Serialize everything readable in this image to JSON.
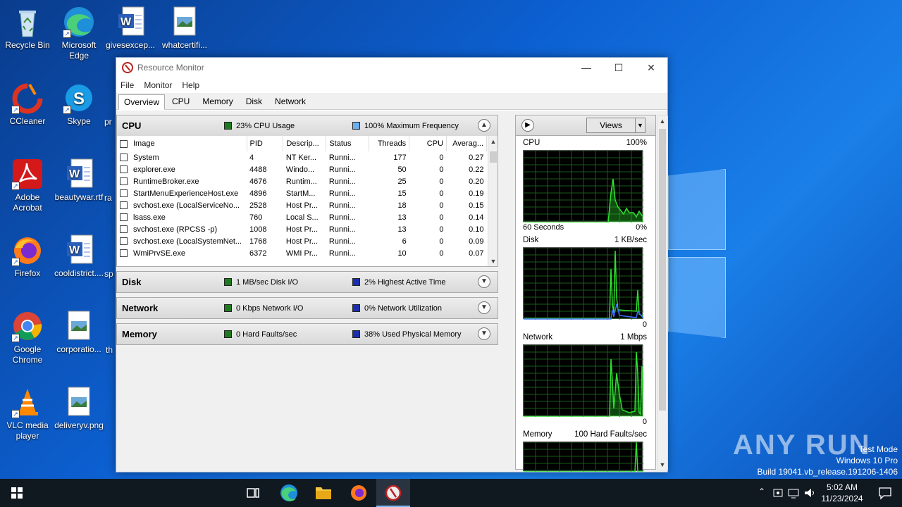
{
  "desktop": {
    "icons": [
      {
        "label": "Recycle Bin"
      },
      {
        "label": "Microsoft Edge"
      },
      {
        "label": "givesexcep..."
      },
      {
        "label": "whatcertifi..."
      },
      {
        "label": "CCleaner"
      },
      {
        "label": "Skype"
      },
      {
        "label": "Adobe Acrobat"
      },
      {
        "label": "beautywar.rtf"
      },
      {
        "label": "Firefox"
      },
      {
        "label": "cooldistrict...."
      },
      {
        "label": "Google Chrome"
      },
      {
        "label": "corporatio..."
      },
      {
        "label": "VLC media player"
      },
      {
        "label": "deliveryv.png"
      }
    ],
    "partial_labels": [
      "pr",
      "ra",
      "sp",
      "th"
    ]
  },
  "window": {
    "title": "Resource Monitor",
    "menu": [
      "File",
      "Monitor",
      "Help"
    ],
    "tabs": [
      "Overview",
      "CPU",
      "Memory",
      "Disk",
      "Network"
    ],
    "active_tab": "Overview"
  },
  "sections": {
    "cpu": {
      "name": "CPU",
      "stat1": "23% CPU Usage",
      "stat2": "100% Maximum Frequency",
      "color1": "#1f7a1f",
      "color2": "#6ab0f0"
    },
    "disk": {
      "name": "Disk",
      "stat1": "1 MB/sec Disk I/O",
      "stat2": "2% Highest Active Time",
      "color1": "#1f7a1f",
      "color2": "#1a2fb0"
    },
    "network": {
      "name": "Network",
      "stat1": "0 Kbps Network I/O",
      "stat2": "0% Network Utilization",
      "color1": "#1f7a1f",
      "color2": "#1a2fb0"
    },
    "memory": {
      "name": "Memory",
      "stat1": "0 Hard Faults/sec",
      "stat2": "38% Used Physical Memory",
      "color1": "#1f7a1f",
      "color2": "#1a2fb0"
    }
  },
  "cpu_table": {
    "headers": [
      "Image",
      "PID",
      "Descrip...",
      "Status",
      "Threads",
      "CPU",
      "Averag..."
    ],
    "rows": [
      [
        "System",
        "4",
        "NT Ker...",
        "Runni...",
        "177",
        "0",
        "0.27"
      ],
      [
        "explorer.exe",
        "4488",
        "Windo...",
        "Runni...",
        "50",
        "0",
        "0.22"
      ],
      [
        "RuntimeBroker.exe",
        "4676",
        "Runtim...",
        "Runni...",
        "25",
        "0",
        "0.20"
      ],
      [
        "StartMenuExperienceHost.exe",
        "4896",
        "StartM...",
        "Runni...",
        "15",
        "0",
        "0.19"
      ],
      [
        "svchost.exe (LocalServiceNo...",
        "2528",
        "Host Pr...",
        "Runni...",
        "18",
        "0",
        "0.15"
      ],
      [
        "lsass.exe",
        "760",
        "Local S...",
        "Runni...",
        "13",
        "0",
        "0.14"
      ],
      [
        "svchost.exe (RPCSS -p)",
        "1008",
        "Host Pr...",
        "Runni...",
        "13",
        "0",
        "0.10"
      ],
      [
        "svchost.exe (LocalSystemNet...",
        "1768",
        "Host Pr...",
        "Runni...",
        "6",
        "0",
        "0.09"
      ],
      [
        "WmiPrvSE.exe",
        "6372",
        "WMI Pr...",
        "Runni...",
        "10",
        "0",
        "0.07"
      ]
    ]
  },
  "right_pane": {
    "views_label": "Views",
    "graphs": [
      {
        "name": "CPU",
        "top_right": "100%",
        "bottom_left": "60 Seconds",
        "bottom_right": "0%"
      },
      {
        "name": "Disk",
        "top_right": "1 KB/sec",
        "bottom_left": "",
        "bottom_right": "0"
      },
      {
        "name": "Network",
        "top_right": "1 Mbps",
        "bottom_left": "",
        "bottom_right": "0"
      },
      {
        "name": "Memory",
        "top_right": "100 Hard Faults/sec",
        "bottom_left": "",
        "bottom_right": ""
      }
    ]
  },
  "taskbar": {
    "time": "5:02 AM",
    "date": "11/23/2024"
  },
  "watermark": {
    "text": "ANY RUN"
  },
  "system_info": {
    "line1": "Test Mode",
    "line2": "Windows 10 Pro",
    "line3": "Build 19041.vb_release.191206-1406"
  }
}
